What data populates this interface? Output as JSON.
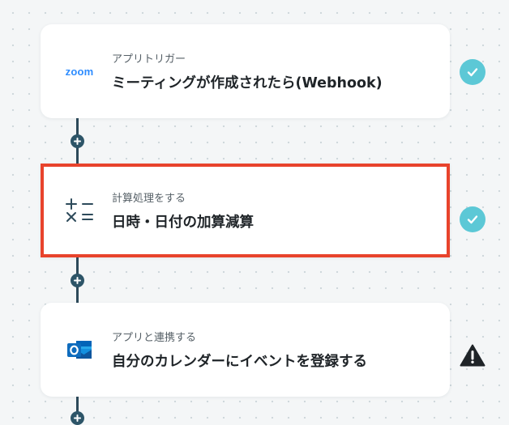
{
  "flow": {
    "steps": [
      {
        "subtitle": "アプリトリガー",
        "title": "ミーティングが作成されたら(Webhook)",
        "icon": "zoom-logo-icon",
        "app_logo_text": "zoom",
        "status": "complete",
        "status_icon": "check-circle-icon"
      },
      {
        "subtitle": "計算処理をする",
        "title": "日時・日付の加算減算",
        "icon": "calculator-operators-icon",
        "status": "complete",
        "status_icon": "check-circle-icon",
        "selected": true
      },
      {
        "subtitle": "アプリと連携する",
        "title": "自分のカレンダーにイベントを登録する",
        "icon": "outlook-icon",
        "status": "warning",
        "status_icon": "warning-triangle-icon"
      }
    ],
    "add_step_icon": "plus-icon"
  },
  "colors": {
    "selected_border": "#e8432c",
    "status_ok": "#5cc8d6",
    "connector": "#2d4a5a",
    "zoom_brand": "#2d8cff",
    "outlook_brand": "#0f6cbd"
  }
}
